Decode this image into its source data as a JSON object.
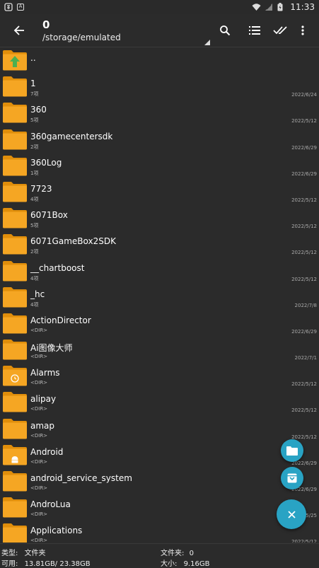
{
  "status": {
    "time": "11:33",
    "left_icon_a": "A"
  },
  "appbar": {
    "title": "0",
    "path": "/storage/emulated"
  },
  "items": [
    {
      "name": "..",
      "sub": "",
      "date": "",
      "icon": "folder-up"
    },
    {
      "name": "1",
      "sub": "7项",
      "date": "2022/6/24",
      "icon": "folder"
    },
    {
      "name": "360",
      "sub": "5项",
      "date": "2022/5/12",
      "icon": "folder"
    },
    {
      "name": "360gamecentersdk",
      "sub": "2项",
      "date": "2022/6/29",
      "icon": "folder"
    },
    {
      "name": "360Log",
      "sub": "1项",
      "date": "2022/6/29",
      "icon": "folder"
    },
    {
      "name": "7723",
      "sub": "4项",
      "date": "2022/5/12",
      "icon": "folder"
    },
    {
      "name": "6071Box",
      "sub": "5项",
      "date": "2022/5/12",
      "icon": "folder"
    },
    {
      "name": "6071GameBox2SDK",
      "sub": "2项",
      "date": "2022/5/12",
      "icon": "folder"
    },
    {
      "name": "__chartboost",
      "sub": "4项",
      "date": "2022/5/12",
      "icon": "folder"
    },
    {
      "name": "_hc",
      "sub": "4项",
      "date": "2022/7/8",
      "icon": "folder"
    },
    {
      "name": "ActionDirector",
      "sub": "<DIR>",
      "date": "2022/6/29",
      "icon": "folder"
    },
    {
      "name": "Ai图像大师",
      "sub": "<DIR>",
      "date": "2022/7/1",
      "icon": "folder"
    },
    {
      "name": "Alarms",
      "sub": "<DIR>",
      "date": "2022/5/12",
      "icon": "folder-alarm"
    },
    {
      "name": "alipay",
      "sub": "<DIR>",
      "date": "2022/5/12",
      "icon": "folder"
    },
    {
      "name": "amap",
      "sub": "<DIR>",
      "date": "2022/5/12",
      "icon": "folder"
    },
    {
      "name": "Android",
      "sub": "<DIR>",
      "date": "2022/6/29",
      "icon": "folder-android"
    },
    {
      "name": "android_service_system",
      "sub": "<DIR>",
      "date": "2022/6/29",
      "icon": "folder"
    },
    {
      "name": "AndroLua",
      "sub": "<DIR>",
      "date": "2022/5/25",
      "icon": "folder"
    },
    {
      "name": "Applications",
      "sub": "<DIR>",
      "date": "2022/5/12",
      "icon": "folder"
    }
  ],
  "footer": {
    "type_label": "类型:",
    "type_value": "文件夹",
    "folder_label": "文件夹:",
    "folder_value": "0",
    "avail_label": "可用:",
    "avail_value": "13.81GB/ 23.38GB",
    "size_label": "大小:",
    "size_value": "9.16GB"
  },
  "colors": {
    "folder": "#f5a623",
    "folder_dark": "#e08e0b",
    "accent": "#29a3c4",
    "up_arrow": "#4caf50"
  }
}
